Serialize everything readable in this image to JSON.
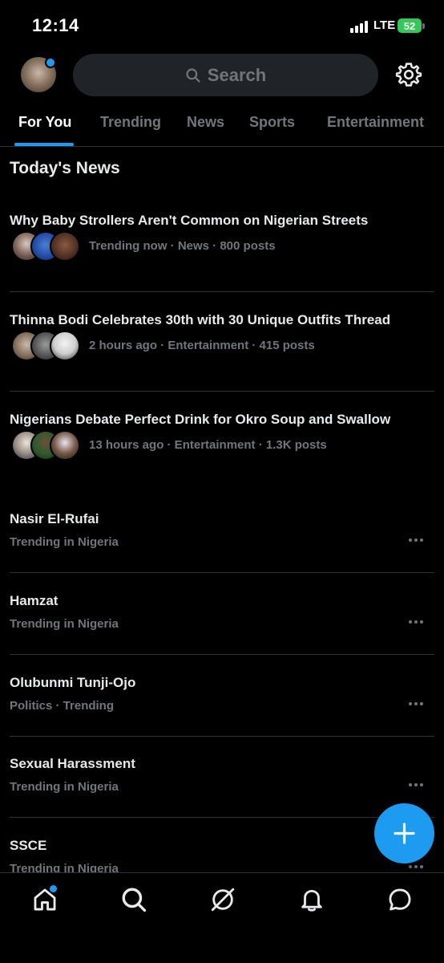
{
  "status_bar": {
    "time": "12:14",
    "network": "LTE",
    "battery": "52"
  },
  "search": {
    "label": "Search"
  },
  "tabs": [
    {
      "label": "For You",
      "active": true
    },
    {
      "label": "Trending"
    },
    {
      "label": "News"
    },
    {
      "label": "Sports"
    },
    {
      "label": "Entertainment"
    }
  ],
  "section_title": "Today's News",
  "news": [
    {
      "title": "Why Baby Strollers Aren't Common on Nigerian Streets",
      "meta": "Trending now · News · 800 posts"
    },
    {
      "title": "Thinna Bodi Celebrates 30th with 30 Unique Outfits Thread",
      "meta": "2 hours ago · Entertainment · 415 posts"
    },
    {
      "title": "Nigerians Debate Perfect Drink for Okro Soup and Swallow",
      "meta": "13 hours ago · Entertainment · 1.3K posts"
    }
  ],
  "trends": [
    {
      "title": "Nasir El-Rufai",
      "subtitle": "Trending in Nigeria"
    },
    {
      "title": "Hamzat",
      "subtitle": "Trending in Nigeria"
    },
    {
      "title": "Olubunmi Tunji-Ojo",
      "subtitle": "Politics · Trending"
    },
    {
      "title": "Sexual Harassment",
      "subtitle": "Trending in Nigeria"
    },
    {
      "title": "SSCE",
      "subtitle": "Trending in Nigeria"
    }
  ],
  "colors": {
    "accent": "#1d9bf0",
    "background": "#000000",
    "secondary_text": "#71767b",
    "divider": "#2f3336"
  },
  "icons": [
    "search-icon",
    "gear-icon",
    "compose-plus-icon",
    "home-icon",
    "explore-icon",
    "grok-icon",
    "notifications-bell-icon",
    "messages-icon"
  ]
}
